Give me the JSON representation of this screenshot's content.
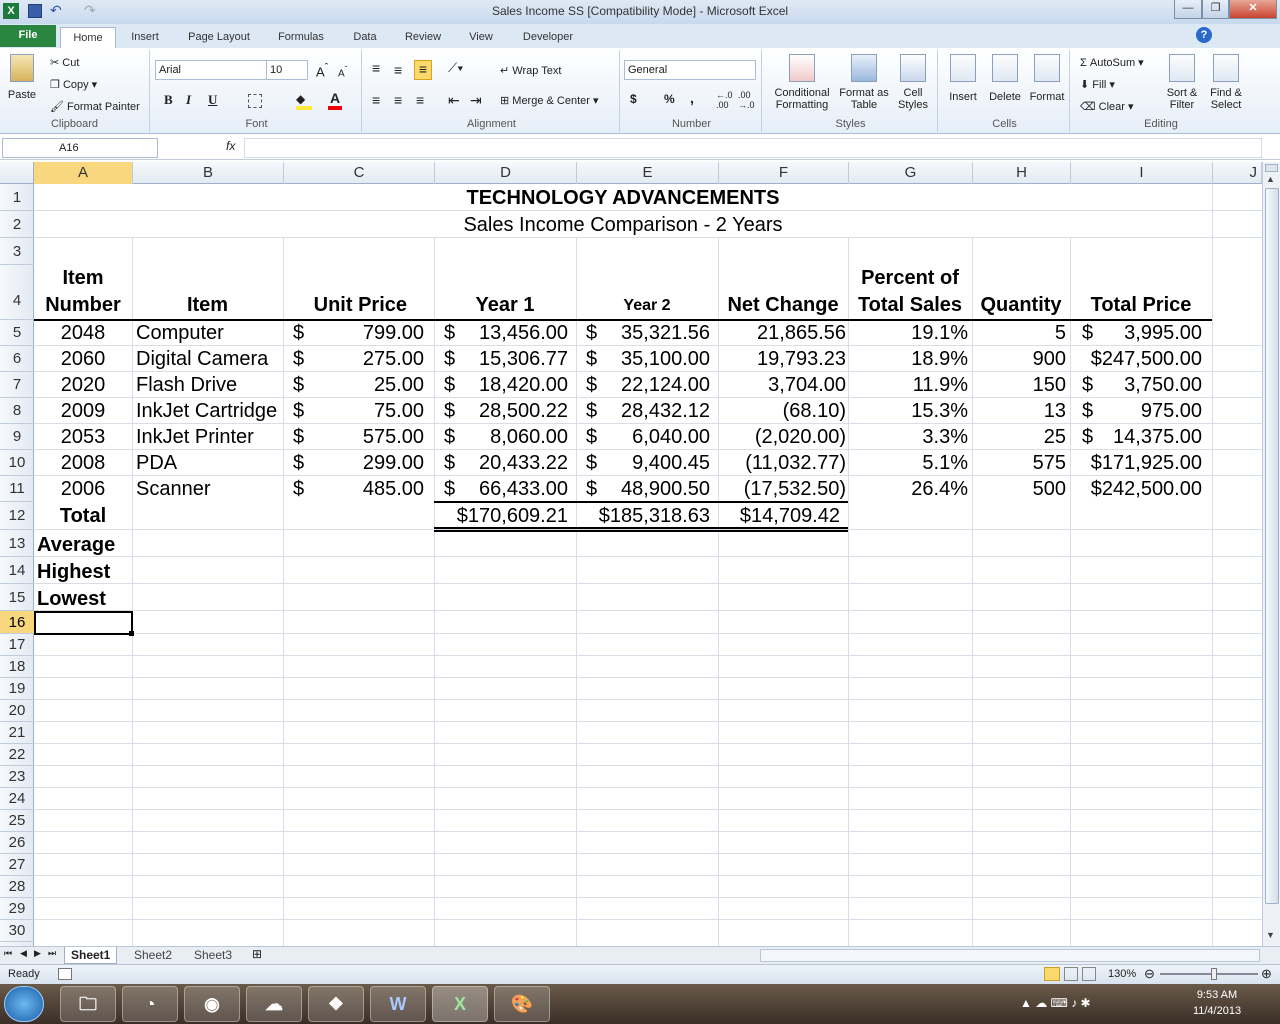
{
  "window": {
    "title": "Sales Income SS  [Compatibility Mode]  -  Microsoft Excel",
    "minimize": "—",
    "restore": "❐",
    "close": "✕"
  },
  "ribbon_tabs": [
    "File",
    "Home",
    "Insert",
    "Page Layout",
    "Formulas",
    "Data",
    "Review",
    "View",
    "Developer"
  ],
  "ribbon": {
    "clipboard": {
      "paste": "Paste",
      "cut": "Cut",
      "copy": "Copy",
      "format_painter": "Format Painter",
      "label": "Clipboard"
    },
    "font": {
      "name": "Arial",
      "size": "10",
      "label": "Font",
      "bold": "B",
      "italic": "I",
      "underline": "U"
    },
    "alignment": {
      "wrap": "Wrap Text",
      "merge": "Merge & Center",
      "label": "Alignment"
    },
    "number": {
      "format": "General",
      "currency": "$",
      "percent": "%",
      "comma": ",",
      "label": "Number"
    },
    "styles": {
      "conditional": "Conditional Formatting",
      "format_table": "Format as Table",
      "cell_styles": "Cell Styles",
      "label": "Styles"
    },
    "cells": {
      "insert": "Insert",
      "delete": "Delete",
      "format": "Format",
      "label": "Cells"
    },
    "editing": {
      "autosum": "AutoSum",
      "fill": "Fill",
      "clear": "Clear",
      "sort": "Sort & Filter",
      "find": "Find & Select",
      "label": "Editing"
    }
  },
  "formula_bar": {
    "name_box": "A16",
    "fx": "fx",
    "value": ""
  },
  "columns": [
    "A",
    "B",
    "C",
    "D",
    "E",
    "F",
    "G",
    "H",
    "I",
    "J"
  ],
  "rows": [
    "1",
    "2",
    "3",
    "4",
    "5",
    "6",
    "7",
    "8",
    "9",
    "10",
    "11",
    "12",
    "13",
    "14",
    "15",
    "16",
    "17",
    "18",
    "19",
    "20",
    "21",
    "22",
    "23",
    "24",
    "25",
    "26",
    "27",
    "28",
    "29",
    "30"
  ],
  "sheet": {
    "title": "TECHNOLOGY ADVANCEMENTS",
    "subtitle": "Sales Income Comparison - 2 Years",
    "headers": {
      "item_number_1": "Item",
      "item_number_2": "Number",
      "item": "Item",
      "unit_price": "Unit Price",
      "year1": "Year 1",
      "year2": "Year 2",
      "net_change": "Net Change",
      "percent_1": "Percent of",
      "percent_2": "Total Sales",
      "quantity": "Quantity",
      "total_price": "Total Price"
    },
    "data": [
      {
        "num": "2048",
        "item": "Computer",
        "price": "799.00",
        "y1": "13,456.00",
        "y2": "35,321.56",
        "net": "21,865.56",
        "pct": "19.1%",
        "qty": "5",
        "tp": "3,995.00",
        "tp_sign": true
      },
      {
        "num": "2060",
        "item": "Digital Camera",
        "price": "275.00",
        "y1": "15,306.77",
        "y2": "35,100.00",
        "net": "19,793.23",
        "pct": "18.9%",
        "qty": "900",
        "tp": "$247,500.00",
        "tp_sign": false
      },
      {
        "num": "2020",
        "item": "Flash Drive",
        "price": "25.00",
        "y1": "18,420.00",
        "y2": "22,124.00",
        "net": "3,704.00",
        "pct": "11.9%",
        "qty": "150",
        "tp": "3,750.00",
        "tp_sign": true
      },
      {
        "num": "2009",
        "item": "InkJet Cartridge",
        "price": "75.00",
        "y1": "28,500.22",
        "y2": "28,432.12",
        "net": "(68.10)",
        "pct": "15.3%",
        "qty": "13",
        "tp": "975.00",
        "tp_sign": true
      },
      {
        "num": "2053",
        "item": "InkJet Printer",
        "price": "575.00",
        "y1": "8,060.00",
        "y2": "6,040.00",
        "net": "(2,020.00)",
        "pct": "3.3%",
        "qty": "25",
        "tp": "14,375.00",
        "tp_sign": true
      },
      {
        "num": "2008",
        "item": "PDA",
        "price": "299.00",
        "y1": "20,433.22",
        "y2": "9,400.45",
        "net": "(11,032.77)",
        "pct": "5.1%",
        "qty": "575",
        "tp": "$171,925.00",
        "tp_sign": false
      },
      {
        "num": "2006",
        "item": "Scanner",
        "price": "485.00",
        "y1": "66,433.00",
        "y2": "48,900.50",
        "net": "(17,532.50)",
        "pct": "26.4%",
        "qty": "500",
        "tp": "$242,500.00",
        "tp_sign": false
      }
    ],
    "total_label": "Total",
    "totals": {
      "y1": "$170,609.21",
      "y2": "$185,318.63",
      "net": "$14,709.42"
    },
    "average_label": "Average",
    "highest_label": "Highest",
    "lowest_label": "Lowest",
    "currency": "$"
  },
  "sheet_tabs": [
    "Sheet1",
    "Sheet2",
    "Sheet3"
  ],
  "status": {
    "ready": "Ready",
    "zoom": "130%"
  },
  "taskbar": {
    "time": "9:53 AM",
    "date": "11/4/2013"
  }
}
